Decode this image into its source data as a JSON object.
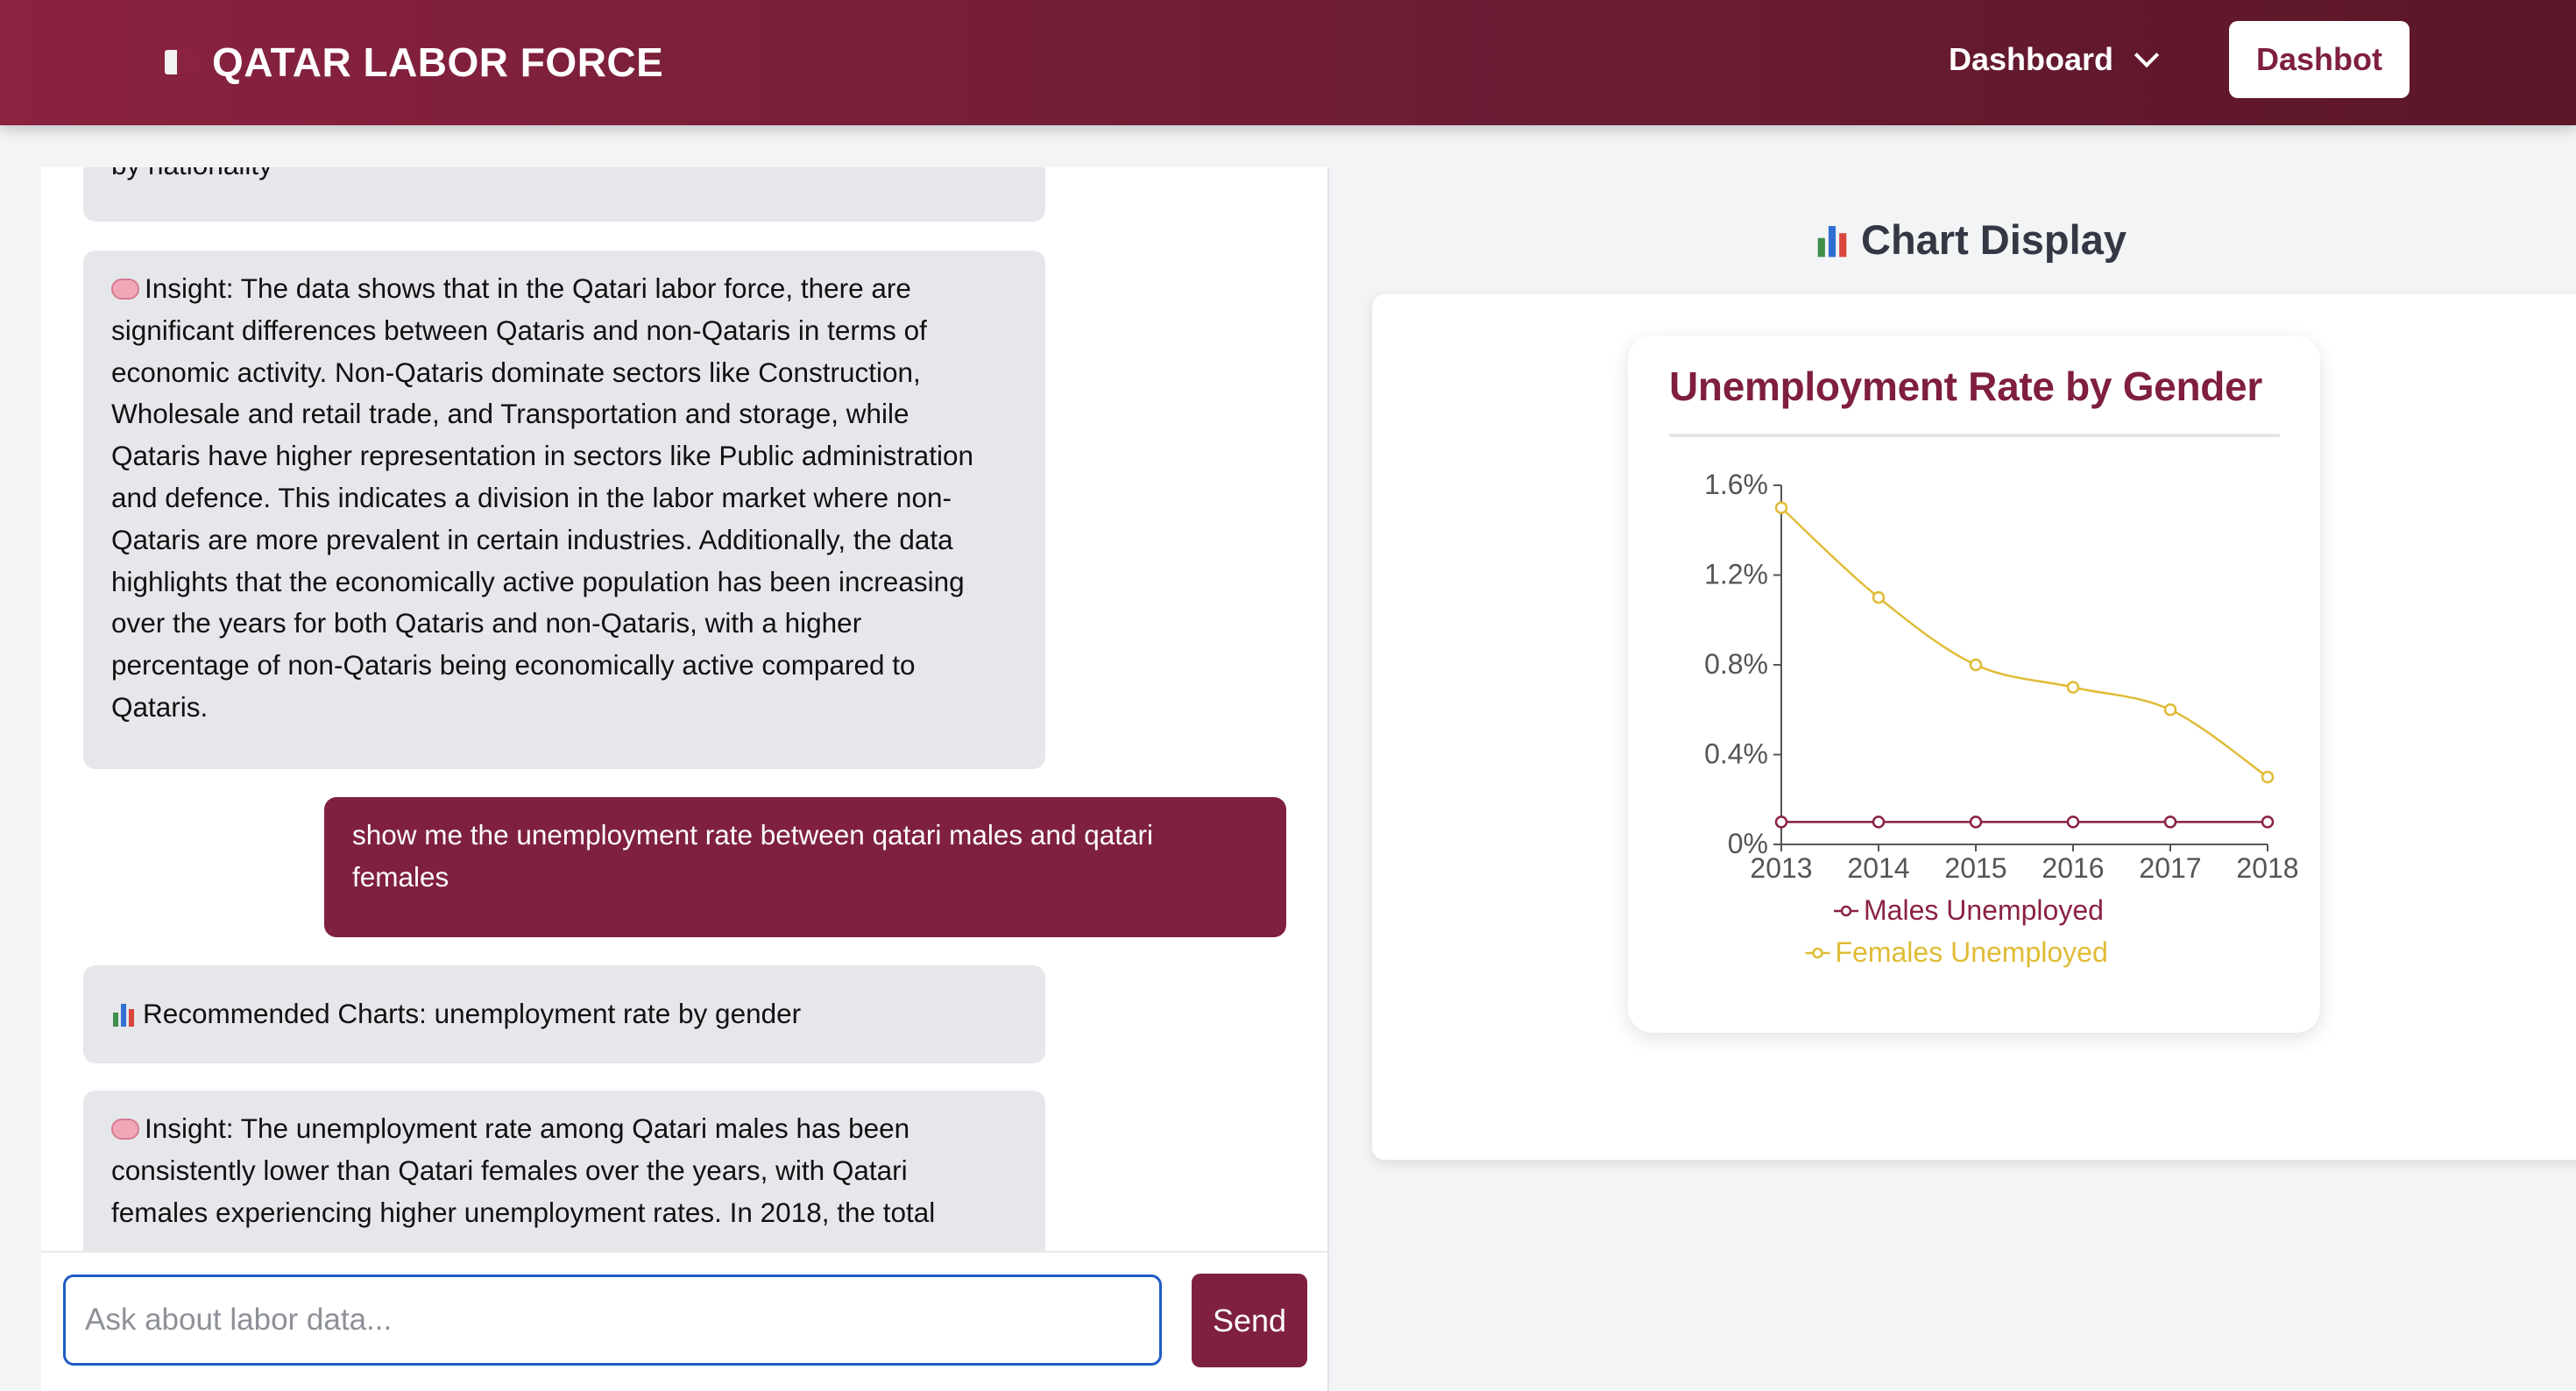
{
  "header": {
    "title": "QATAR LABOR FORCE",
    "nav_dropdown": "Dashboard",
    "dashbot_button": "Dashbot"
  },
  "chat": {
    "messages": [
      {
        "role": "bot",
        "lines": [
          "by nationality"
        ]
      },
      {
        "role": "bot",
        "icon": "brain-icon",
        "lines": [
          "Insight: The data shows that in the Qatari labor force, there are",
          "significant differences between Qataris and non-Qataris in terms of",
          "economic activity. Non-Qataris dominate sectors like Construction,",
          "Wholesale and retail trade, and Transportation and storage, while",
          "Qataris have higher representation in sectors like Public administration",
          "and defence. This indicates a division in the labor market where non-",
          "Qataris are more prevalent in certain industries. Additionally, the data",
          "highlights that the economically active population has been increasing",
          "over the years for both Qataris and non-Qataris, with a higher",
          "percentage of non-Qataris being economically active compared to",
          "Qataris."
        ]
      },
      {
        "role": "user",
        "lines": [
          "show me the unemployment rate between qatari males and qatari",
          "females"
        ]
      },
      {
        "role": "bot",
        "icon": "bar-chart-icon",
        "lines": [
          "Recommended Charts: unemployment rate by gender"
        ]
      },
      {
        "role": "bot",
        "icon": "brain-icon",
        "lines": [
          "Insight: The unemployment rate among Qatari males has been",
          "consistently lower than Qatari females over the years, with Qatari",
          "females experiencing higher unemployment rates. In 2018, the total"
        ]
      }
    ],
    "input_placeholder": "Ask about labor data...",
    "send_label": "Send"
  },
  "chart_panel": {
    "title": "Chart Display"
  },
  "colors": {
    "brand": "#7f213e",
    "males_series": "#8a2240",
    "females_series": "#e0bb36"
  },
  "chart_data": {
    "type": "line",
    "title": "Unemployment Rate by Gender",
    "x": [
      "2013",
      "2014",
      "2015",
      "2016",
      "2017",
      "2018"
    ],
    "x_positions": [
      2013,
      2014,
      2015,
      2016,
      2017,
      2018
    ],
    "series": [
      {
        "name": "Males Unemployed",
        "values": [
          0.1,
          0.1,
          0.1,
          0.1,
          0.1,
          0.1
        ]
      },
      {
        "name": "Females Unemployed",
        "values": [
          1.5,
          1.1,
          0.8,
          0.7,
          0.6,
          0.3
        ]
      }
    ],
    "yticks": [
      0,
      0.4,
      0.8,
      1.2,
      1.6
    ],
    "ytick_labels": [
      "0%",
      "0.4%",
      "0.8%",
      "1.2%",
      "1.6%"
    ],
    "ylim": [
      0,
      1.55
    ],
    "xlabel": "",
    "ylabel": "",
    "legend": "bottom",
    "grid": false
  }
}
